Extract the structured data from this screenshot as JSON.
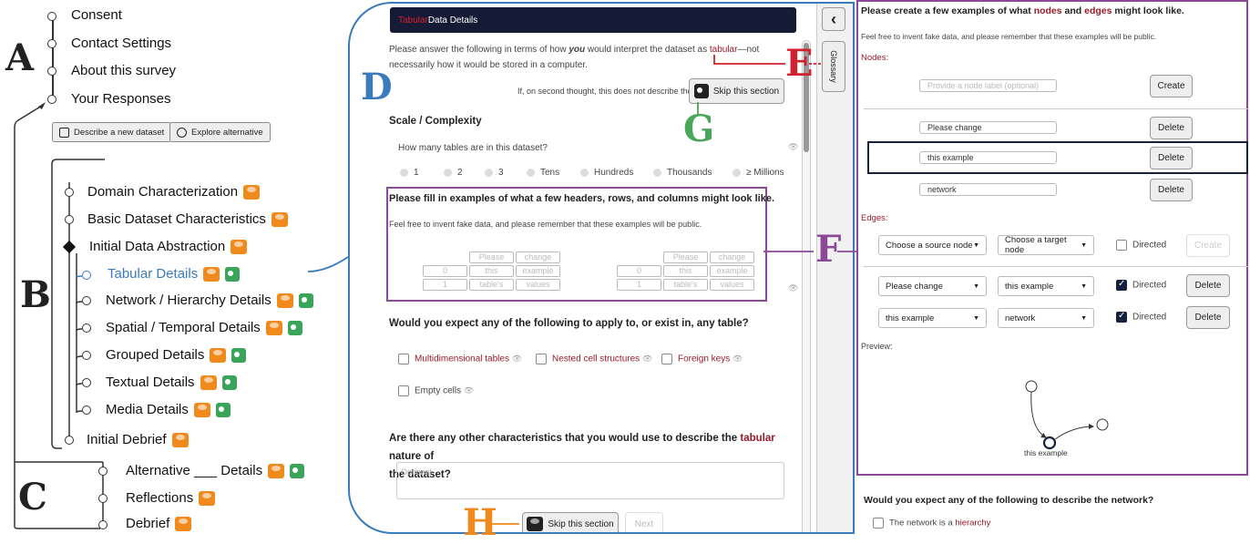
{
  "annotations": {
    "A": "A",
    "B": "B",
    "C": "C",
    "D": "D",
    "E": "E",
    "F": "F",
    "G": "G",
    "H": "H"
  },
  "left_nav": {
    "top_items": [
      "Consent",
      "Contact Settings",
      "About this survey",
      "Your Responses"
    ],
    "describe_button": "Describe a new dataset",
    "explore_button": "Explore alternative",
    "sections": [
      {
        "label": "Domain Characterization",
        "state": "done"
      },
      {
        "label": "Basic Dataset Characteristics",
        "state": "done"
      },
      {
        "label": "Initial Data Abstraction",
        "state": "current"
      },
      {
        "label": "Tabular Details",
        "state": "active"
      },
      {
        "label": "Network / Hierarchy Details",
        "state": "todo"
      },
      {
        "label": "Spatial / Temporal Details",
        "state": "todo"
      },
      {
        "label": "Grouped Details",
        "state": "todo"
      },
      {
        "label": "Textual Details",
        "state": "todo"
      },
      {
        "label": "Media Details",
        "state": "todo"
      },
      {
        "label": "Initial Debrief",
        "state": "todo"
      }
    ],
    "alt_items": [
      "Alternative ___ Details",
      "Reflections",
      "Debrief"
    ]
  },
  "middle": {
    "header_red": "Tabular",
    "header_rest": " Data Details",
    "intro_a": "Please answer the following in terms of how ",
    "intro_you": "you",
    "intro_b": " would interpret the dataset as ",
    "intro_tabular": "tabular",
    "intro_c": "—not",
    "intro_d": "necessarily how it would be stored in a computer.",
    "second_thought": "If, on second thought, this does not describe the data:",
    "skip_label": "Skip this section",
    "scale_heading": "Scale / Complexity",
    "tables_question": "How many tables are in this dataset?",
    "tables_options": [
      "1",
      "2",
      "3",
      "Tens",
      "Hundreds",
      "Thousands",
      "≥ Millions"
    ],
    "examples_heading": "Please fill in examples of what a few headers, rows, and columns might look like.",
    "examples_note": "Feel free to invent fake data, and please remember that these examples will be public.",
    "table_rows": [
      [
        "",
        "Please",
        "change"
      ],
      [
        "0",
        "this",
        "example"
      ],
      [
        "1",
        "table's",
        "values"
      ]
    ],
    "apply_question": "Would you expect any of the following to apply to, or exist in, any table?",
    "apply_options": [
      "Multidimensional tables",
      "Nested cell structures",
      "Foreign keys",
      "Empty cells"
    ],
    "other_question_a": "Are there any other characteristics that you would use to describe the ",
    "other_question_tabular": "tabular",
    "other_question_b": " nature of",
    "other_question_c": "the dataset?",
    "optional_placeholder": "Optional",
    "skip_bottom": "Skip this section",
    "next_label": "Next",
    "glossary": "Glossary",
    "back_icon": "‹"
  },
  "right": {
    "title_a": "Please create a few examples of what ",
    "title_nodes": "nodes",
    "title_and": " and ",
    "title_edges": "edges",
    "title_b": " might look like.",
    "note": "Feel free to invent fake data, and please remember that these examples will be public.",
    "nodes_label": "Nodes",
    "node_placeholder": "Provide a node label (optional)",
    "create_label": "Create",
    "nodes": [
      "Please change",
      "this example",
      "network"
    ],
    "delete_label": "Delete",
    "edges_label": "Edges",
    "source_placeholder": "Choose a source node",
    "target_placeholder": "Choose a target node",
    "directed_label": "Directed",
    "edges": [
      {
        "source": "Please change",
        "target": "this example",
        "directed": true
      },
      {
        "source": "this example",
        "target": "network",
        "directed": true
      }
    ],
    "preview_label": "Preview:",
    "preview_node_label": "this example",
    "network_question": "Would you expect any of the following to describe the network?",
    "hierarchy_a": "The network is a ",
    "hierarchy_b": "hierarchy"
  },
  "colors": {
    "blue": "#3a7bbd",
    "red_annotation": "#d0222f",
    "green_annotation": "#4aa65a",
    "orange_annotation": "#f08a1c",
    "purple_annotation": "#8a4a98",
    "header_dark": "#151b35"
  }
}
